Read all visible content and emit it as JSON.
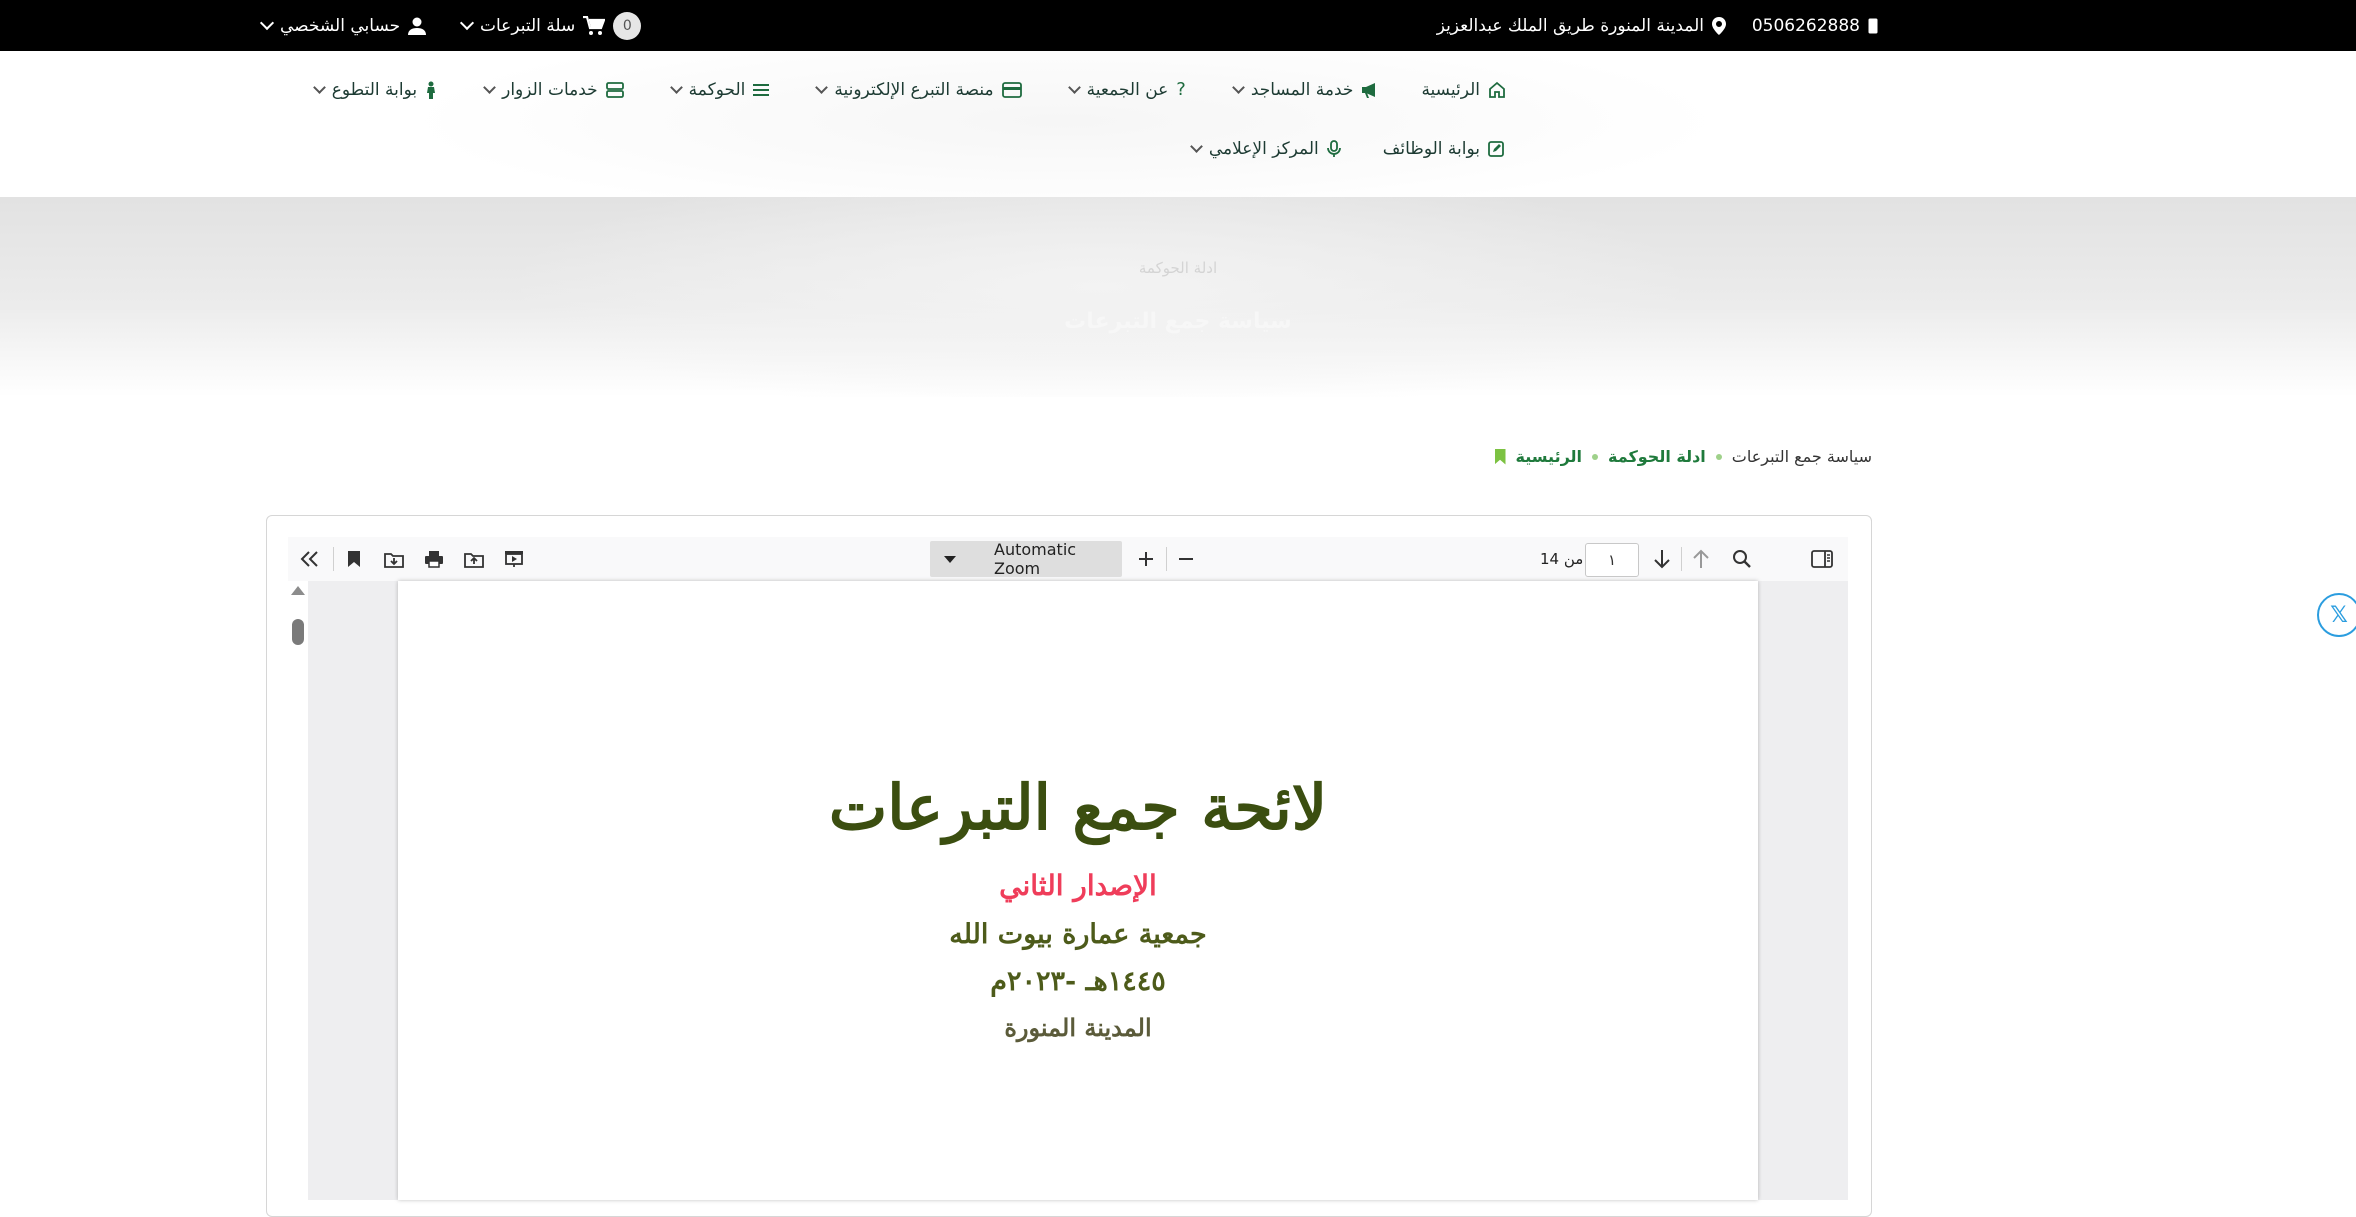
{
  "topbar": {
    "phone": "0506262888",
    "address": "المدينة المنورة طريق الملك عبدالعزيز",
    "cart_label": "سلة التبرعات",
    "cart_count": "0",
    "account_label": "حسابي الشخصي"
  },
  "nav": {
    "row1": [
      {
        "label": "الرئيسية",
        "icon": "home-icon",
        "dropdown": false
      },
      {
        "label": "خدمة المساجد",
        "icon": "megaphone-icon",
        "dropdown": true
      },
      {
        "label": "عن الجمعية",
        "icon": "question-icon",
        "dropdown": true
      },
      {
        "label": "منصة التبرع الإلكترونية",
        "icon": "credit-card-icon",
        "dropdown": true
      },
      {
        "label": "الحوكمة",
        "icon": "list-icon",
        "dropdown": true
      },
      {
        "label": "خدمات الزوار",
        "icon": "server-icon",
        "dropdown": true
      },
      {
        "label": "بوابة التطوع",
        "icon": "person-icon",
        "dropdown": true
      }
    ],
    "row2": [
      {
        "label": "بوابة الوظائف",
        "icon": "edit-icon",
        "dropdown": false
      },
      {
        "label": "المركز الإعلامي",
        "icon": "microphone-icon",
        "dropdown": true
      }
    ]
  },
  "hero": {
    "subtitle": "ادلة الحوكمة",
    "title": "سياسة جمع التبرعات"
  },
  "breadcrumb": {
    "home": "الرئيسية",
    "section": "ادلة الحوكمة",
    "current": "سياسة جمع التبرعات"
  },
  "viewer": {
    "zoom": "Automatic Zoom",
    "page_number": "١",
    "page_total": "من 14"
  },
  "document": {
    "title": "لائحة جمع التبرعات",
    "edition": "الإصدار الثاني",
    "organization": "جمعية عمارة بيوت الله",
    "date": "١٤٤٥هـ -٢٠٢٣م",
    "city": "المدينة المنورة"
  },
  "colors": {
    "accent_green": "#1f7a3c",
    "light_green": "#7cc242",
    "doc_red": "#ef3d5a",
    "twitter_blue": "#2b9ddf"
  }
}
